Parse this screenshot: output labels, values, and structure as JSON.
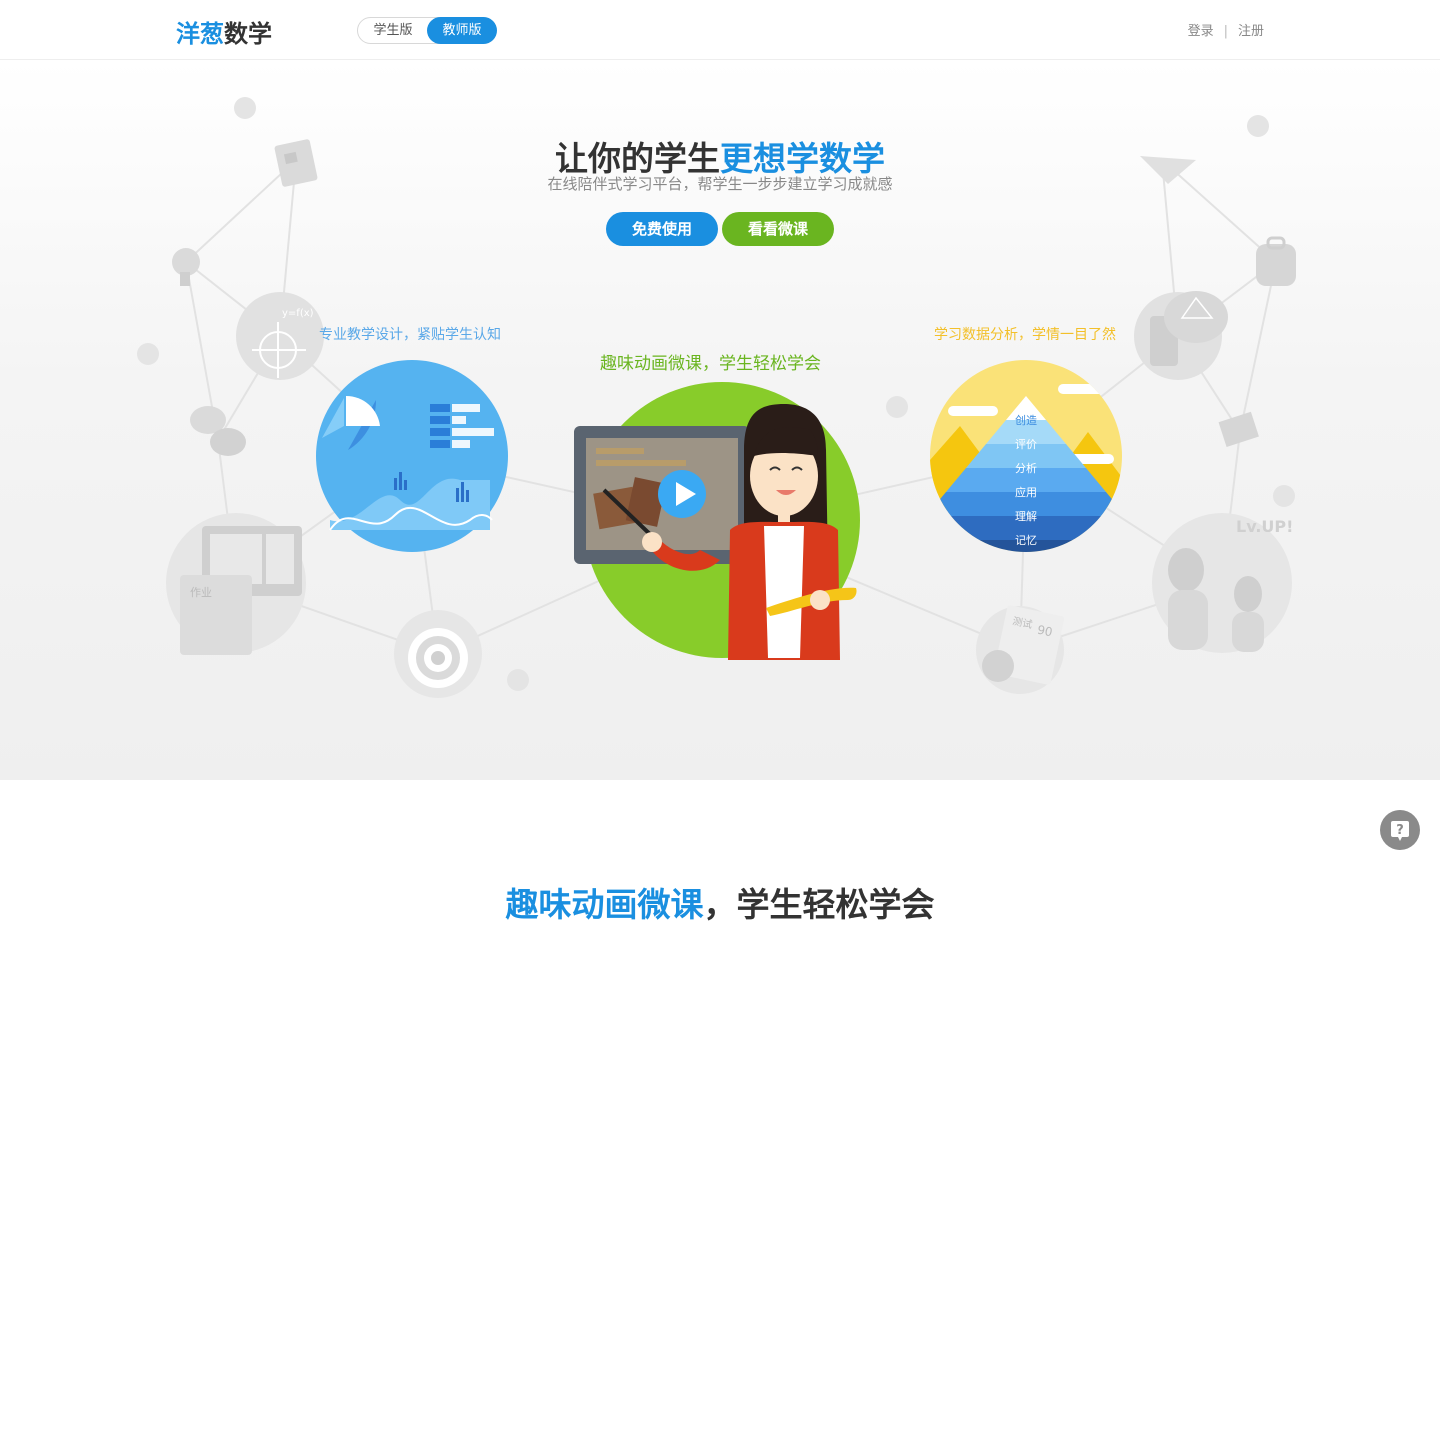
{
  "header": {
    "logo_part1": "洋葱",
    "logo_part2": "数学",
    "version_switch": {
      "student": "学生版",
      "teacher": "教师版",
      "active": "teacher"
    },
    "login": "登录",
    "separator": "|",
    "register": "注册"
  },
  "hero": {
    "title_part1": "让你的学生",
    "title_highlight": "更想学数学",
    "subtitle": "在线陪伴式学习平台，帮学生一步步建立学习成就感",
    "buttons": {
      "free": "免费使用",
      "watch": "看看微课"
    },
    "features": {
      "left": "专业教学设计，紧贴学生认知",
      "center": "趣味动画微课，学生轻松学会",
      "right": "学习数据分析，学情一目了然"
    },
    "pyramid_levels": [
      "创造",
      "评价",
      "分析",
      "应用",
      "理解",
      "记忆"
    ],
    "decor_labels": {
      "homework": "作业",
      "levelup": "Lv.UP!",
      "test": "测试",
      "score": "90",
      "formula": "y=f(x)",
      "ab": "a+b"
    }
  },
  "section": {
    "title_highlight": "趣味动画微课",
    "title_rest": "，学生轻松学会"
  },
  "help_icon": "?",
  "colors": {
    "brand_blue": "#1a8fe0",
    "green": "#6ab520",
    "yellow": "#f3c02a"
  }
}
